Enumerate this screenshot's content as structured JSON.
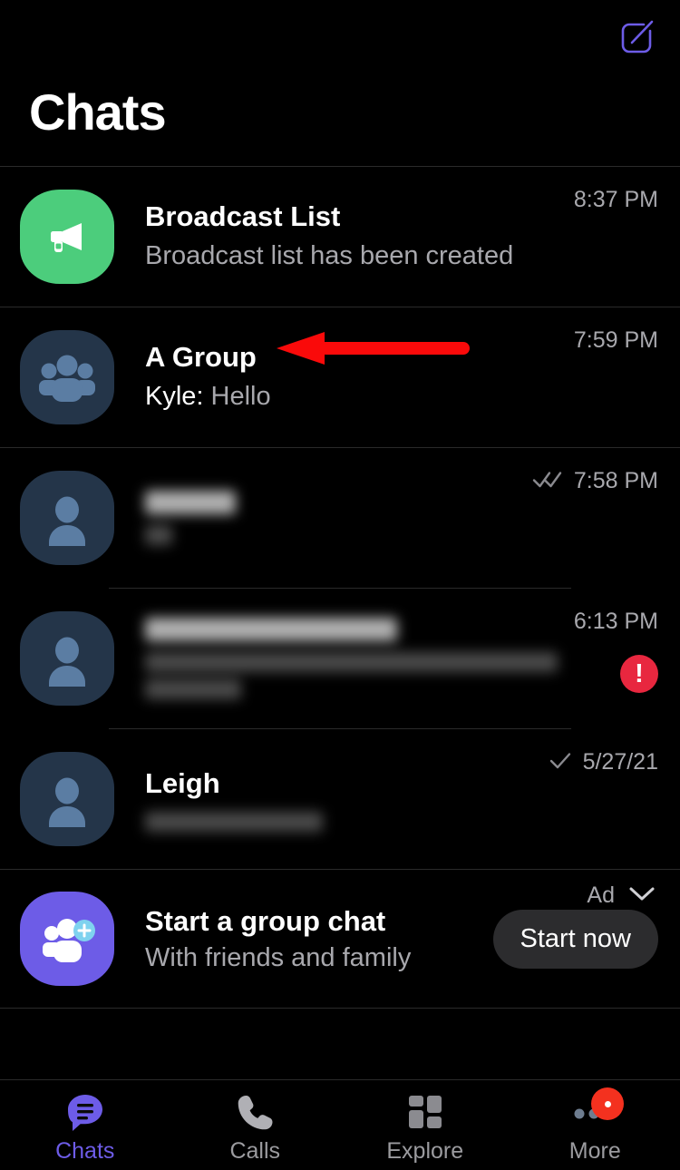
{
  "header": {
    "title": "Chats",
    "compose_icon": "compose-icon"
  },
  "chats": [
    {
      "name": "Broadcast List",
      "preview": "Broadcast list has been created",
      "sender": "",
      "time": "8:37 PM",
      "avatar": "megaphone-icon",
      "avatar_color": "#4ccd7c",
      "status": "",
      "redacted": false,
      "badge": ""
    },
    {
      "name": "A Group",
      "preview": "Hello",
      "sender": "Kyle:",
      "time": "7:59 PM",
      "avatar": "group-people-icon",
      "avatar_color": "#243549",
      "status": "",
      "redacted": false,
      "badge": ""
    },
    {
      "name": "",
      "preview": "",
      "sender": "",
      "time": "7:58 PM",
      "avatar": "person-icon",
      "avatar_color": "#243549",
      "status": "double-check-icon",
      "redacted": true,
      "badge": ""
    },
    {
      "name": "",
      "preview": "",
      "sender": "",
      "time": "6:13 PM",
      "avatar": "person-icon",
      "avatar_color": "#243549",
      "status": "",
      "redacted": true,
      "badge": "!"
    },
    {
      "name": "Leigh",
      "preview": "",
      "sender": "",
      "time": "5/27/21",
      "avatar": "person-icon",
      "avatar_color": "#243549",
      "status": "single-check-icon",
      "redacted": true,
      "badge": ""
    }
  ],
  "ad": {
    "label": "Ad",
    "title": "Start a group chat",
    "subtitle": "With friends and family",
    "cta": "Start now",
    "avatar": "add-group-icon",
    "avatar_color": "#6d5ce7",
    "chevron_icon": "chevron-down-icon"
  },
  "bottom_nav": {
    "items": [
      {
        "label": "Chats",
        "icon": "chat-bubble-icon",
        "active": true,
        "badge": false
      },
      {
        "label": "Calls",
        "icon": "phone-icon",
        "active": false,
        "badge": false
      },
      {
        "label": "Explore",
        "icon": "grid-icon",
        "active": false,
        "badge": false
      },
      {
        "label": "More",
        "icon": "more-dots-icon",
        "active": false,
        "badge": true
      }
    ]
  },
  "annotation": {
    "type": "arrow",
    "color": "#fa0a0a",
    "points_to": "A Group"
  },
  "colors": {
    "background": "#000000",
    "accent": "#6d5ce7",
    "text_primary": "#ffffff",
    "text_secondary": "#a8a8ad",
    "divider": "#2a2a2a",
    "error": "#e8273f",
    "badge": "#f4311f"
  }
}
